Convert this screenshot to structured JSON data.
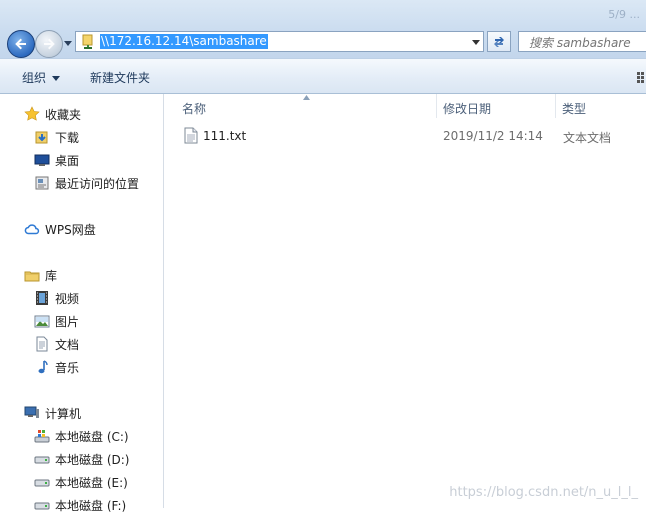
{
  "window": {
    "ghost_title": "5/9 ..."
  },
  "address_bar": {
    "path": "\\\\172.16.12.14\\sambashare"
  },
  "search": {
    "placeholder": "搜索 sambashare"
  },
  "toolbar": {
    "organize_label": "组织",
    "new_folder_label": "新建文件夹"
  },
  "nav": {
    "favorites": {
      "label": "收藏夹",
      "items": [
        "下载",
        "桌面",
        "最近访问的位置"
      ]
    },
    "wps": {
      "label": "WPS网盘"
    },
    "libraries": {
      "label": "库",
      "items": [
        "视频",
        "图片",
        "文档",
        "音乐"
      ]
    },
    "computer": {
      "label": "计算机",
      "items": [
        "本地磁盘 (C:)",
        "本地磁盘 (D:)",
        "本地磁盘 (E:)",
        "本地磁盘 (F:)"
      ]
    }
  },
  "columns": {
    "name": "名称",
    "modified": "修改日期",
    "type": "类型"
  },
  "files": [
    {
      "name": "111.txt",
      "modified": "2019/11/2 14:14",
      "type": "文本文档"
    }
  ],
  "watermark": "https://blog.csdn.net/n_u_l_l_",
  "colors": {
    "accent": "#3399ff",
    "header_bg": "#dbe8f5"
  }
}
